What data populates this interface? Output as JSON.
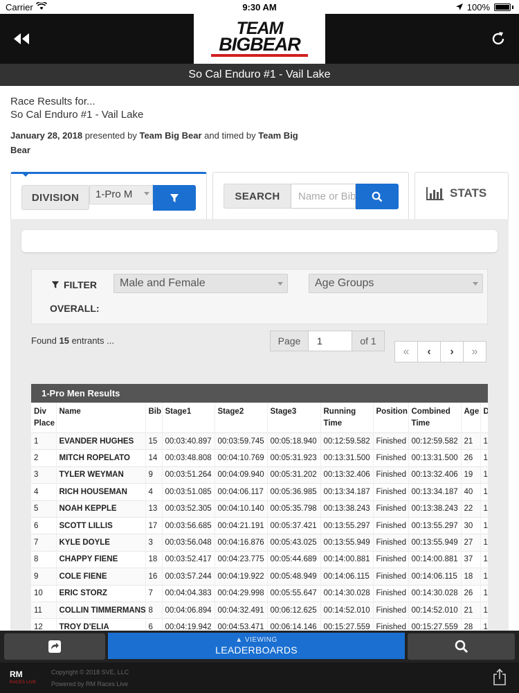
{
  "status_bar": {
    "carrier": "Carrier",
    "time": "9:30 AM",
    "battery": "100%"
  },
  "header": {
    "logo_line1": "TEAM",
    "logo_line2": "BIGBEAR",
    "race_title": "So Cal Enduro #1 - Vail Lake"
  },
  "info": {
    "line1": "Race Results for...",
    "line2": "So Cal Enduro #1 - Vail Lake",
    "date": "January 28, 2018",
    "presented_by_text": " presented by ",
    "presenter": "Team Big Bear",
    "timed_by_text": " and timed by ",
    "timer": "Team Big Bear"
  },
  "tabs": {
    "division_label": "DIVISION",
    "division_value": "1-Pro M",
    "search_label": "SEARCH",
    "search_placeholder": "Name or Bib",
    "stats_label": "STATS"
  },
  "filters": {
    "filter_label": "FILTER",
    "overall_label": "OVERALL:",
    "gender_value": "Male and Female",
    "age_value": "Age Groups"
  },
  "found": {
    "prefix": "Found ",
    "count": "15",
    "suffix": " entrants ..."
  },
  "pager": {
    "page_label": "Page",
    "page_value": "1",
    "of_label": "of 1",
    "first": "«",
    "prev": "‹",
    "next": "›",
    "last": "»"
  },
  "results": {
    "title": "1-Pro Men Results",
    "columns": [
      "Div Place",
      "Name",
      "Bib",
      "Stage1",
      "Stage2",
      "Stage3",
      "Running Time",
      "Position",
      "Combined Time",
      "Age",
      "D"
    ],
    "rows": [
      [
        "1",
        "EVANDER HUGHES",
        "15",
        "00:03:40.897",
        "00:03:59.745",
        "00:05:18.940",
        "00:12:59.582",
        "Finished",
        "00:12:59.582",
        "21",
        "1"
      ],
      [
        "2",
        "MITCH ROPELATO",
        "14",
        "00:03:48.808",
        "00:04:10.769",
        "00:05:31.923",
        "00:13:31.500",
        "Finished",
        "00:13:31.500",
        "26",
        "1"
      ],
      [
        "3",
        "TYLER WEYMAN",
        "9",
        "00:03:51.264",
        "00:04:09.940",
        "00:05:31.202",
        "00:13:32.406",
        "Finished",
        "00:13:32.406",
        "19",
        "1"
      ],
      [
        "4",
        "RICH HOUSEMAN",
        "4",
        "00:03:51.085",
        "00:04:06.117",
        "00:05:36.985",
        "00:13:34.187",
        "Finished",
        "00:13:34.187",
        "40",
        "1"
      ],
      [
        "5",
        "NOAH KEPPLE",
        "13",
        "00:03:52.305",
        "00:04:10.140",
        "00:05:35.798",
        "00:13:38.243",
        "Finished",
        "00:13:38.243",
        "22",
        "1"
      ],
      [
        "6",
        "SCOTT LILLIS",
        "17",
        "00:03:56.685",
        "00:04:21.191",
        "00:05:37.421",
        "00:13:55.297",
        "Finished",
        "00:13:55.297",
        "30",
        "1"
      ],
      [
        "7",
        "KYLE DOYLE",
        "3",
        "00:03:56.048",
        "00:04:16.876",
        "00:05:43.025",
        "00:13:55.949",
        "Finished",
        "00:13:55.949",
        "27",
        "1"
      ],
      [
        "8",
        "CHAPPY FIENE",
        "18",
        "00:03:52.417",
        "00:04:23.775",
        "00:05:44.689",
        "00:14:00.881",
        "Finished",
        "00:14:00.881",
        "37",
        "1"
      ],
      [
        "9",
        "COLE FIENE",
        "16",
        "00:03:57.244",
        "00:04:19.922",
        "00:05:48.949",
        "00:14:06.115",
        "Finished",
        "00:14:06.115",
        "18",
        "1"
      ],
      [
        "10",
        "ERIC STORZ",
        "7",
        "00:04:04.383",
        "00:04:29.998",
        "00:05:55.647",
        "00:14:30.028",
        "Finished",
        "00:14:30.028",
        "26",
        "1"
      ],
      [
        "11",
        "COLLIN TIMMERMANS",
        "8",
        "00:04:06.894",
        "00:04:32.491",
        "00:06:12.625",
        "00:14:52.010",
        "Finished",
        "00:14:52.010",
        "21",
        "1"
      ],
      [
        "12",
        "TROY D'ELIA",
        "6",
        "00:04:19.942",
        "00:04:53.471",
        "00:06:14.146",
        "00:15:27.559",
        "Finished",
        "00:15:27.559",
        "28",
        "1"
      ]
    ]
  },
  "bottom_nav": {
    "viewing_label": "VIEWING",
    "leaderboards_label": "LEADERBOARDS"
  },
  "footer": {
    "brand_main": "RM",
    "brand_sub": "RACES LIVE",
    "copyright": "Copyright © 2018 SVE, LLC",
    "powered_by": "Powered by RM Races Live"
  },
  "colors": {
    "accent": "#1a6fd1",
    "header_bg": "#111111",
    "logo_red": "#d21f1f"
  }
}
